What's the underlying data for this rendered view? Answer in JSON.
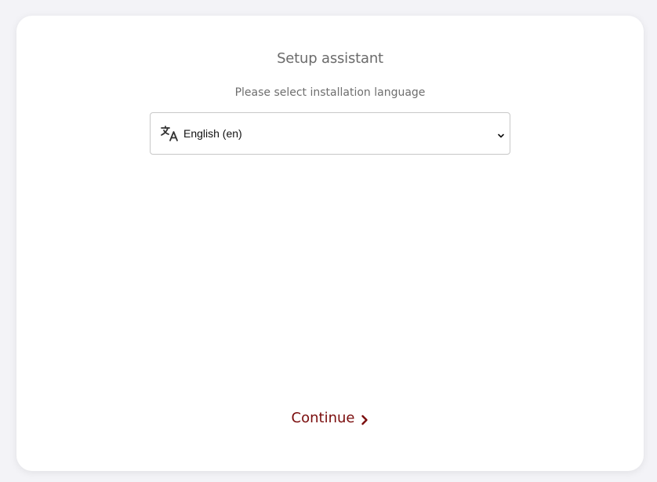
{
  "setup": {
    "title": "Setup assistant",
    "subtitle": "Please select installation language",
    "language_select": {
      "selected": "English (en)",
      "icon": "translate-icon"
    },
    "continue_label": "Continue",
    "continue_icon": "chevron-right-icon"
  },
  "colors": {
    "background": "#f3f3f7",
    "card": "#ffffff",
    "accent": "#7a0c0c",
    "text_muted": "#6b6b6b"
  }
}
